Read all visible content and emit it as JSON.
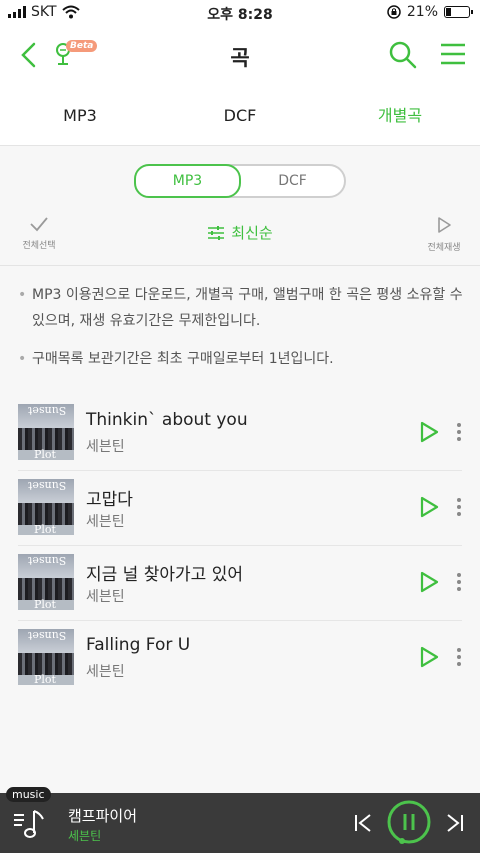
{
  "status": {
    "carrier": "SKT",
    "time": "오후 8:28",
    "battery": "21%",
    "battery_level": 0.21
  },
  "header": {
    "title": "곡",
    "beta": "Beta",
    "back_icon": "chevron-left-icon",
    "search_icon": "search-icon",
    "menu_icon": "hamburger-icon"
  },
  "tabs": [
    {
      "label": "MP3",
      "active": false
    },
    {
      "label": "DCF",
      "active": false
    },
    {
      "label": "개별곡",
      "active": true
    }
  ],
  "segment": {
    "options": [
      "MP3",
      "DCF"
    ],
    "selected": "MP3"
  },
  "actions": {
    "select_all": "전체선택",
    "sort": "최신순",
    "play_all": "전체재생"
  },
  "notices": [
    "MP3 이용권으로 다운로드, 개별곡 구매, 앨범구매 한 곡은 평생 소유할 수 있으며, 재생 유효기간은 무제한입니다.",
    "구매목록 보관기간은 최초 구매일로부터 1년입니다."
  ],
  "album_art": {
    "top": "Sunset",
    "bottom": "Plot"
  },
  "songs": [
    {
      "title": "Thinkin` about you",
      "artist": "세븐틴"
    },
    {
      "title": "고맙다",
      "artist": "세븐틴"
    },
    {
      "title": "지금 널 찾아가고 있어",
      "artist": "세븐틴"
    },
    {
      "title": "Falling For U",
      "artist": "세븐틴"
    }
  ],
  "player": {
    "tag": "music",
    "title": "캠프파이어",
    "artist": "세븐틴"
  },
  "colors": {
    "accent": "#3fbf3f",
    "player_bg": "#3a3a3a"
  }
}
